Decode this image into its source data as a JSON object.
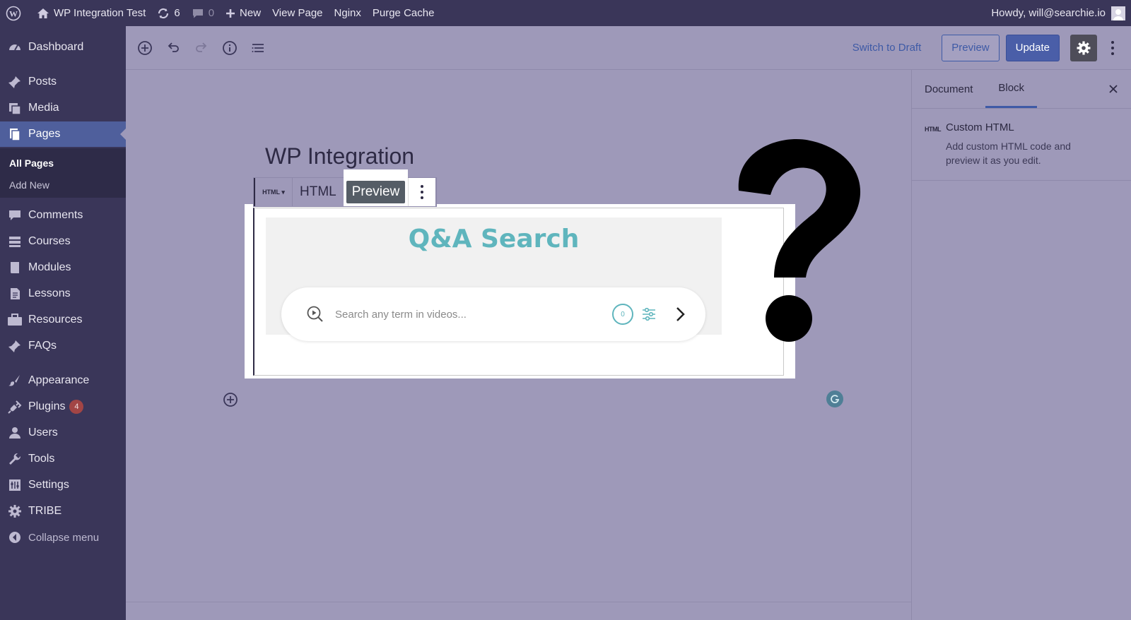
{
  "admin_bar": {
    "site_name": "WP Integration Test",
    "updates_count": "6",
    "comments_count": "0",
    "new_label": "New",
    "view_page": "View Page",
    "nginx": "Nginx",
    "purge_cache": "Purge Cache",
    "howdy": "Howdy, will@searchie.io"
  },
  "sidebar": {
    "items": [
      {
        "label": "Dashboard",
        "icon": "dashboard-icon"
      },
      {
        "label": "Posts",
        "icon": "pin-icon"
      },
      {
        "label": "Media",
        "icon": "media-icon"
      },
      {
        "label": "Pages",
        "icon": "pages-icon",
        "active": true
      },
      {
        "label": "Comments",
        "icon": "comment-icon"
      },
      {
        "label": "Courses",
        "icon": "courses-icon"
      },
      {
        "label": "Modules",
        "icon": "book-icon"
      },
      {
        "label": "Lessons",
        "icon": "document-icon"
      },
      {
        "label": "Resources",
        "icon": "briefcase-icon"
      },
      {
        "label": "FAQs",
        "icon": "pin-icon"
      },
      {
        "label": "Appearance",
        "icon": "brush-icon"
      },
      {
        "label": "Plugins",
        "icon": "plugin-icon",
        "badge": "4"
      },
      {
        "label": "Users",
        "icon": "user-icon"
      },
      {
        "label": "Tools",
        "icon": "wrench-icon"
      },
      {
        "label": "Settings",
        "icon": "settings-icon"
      },
      {
        "label": "TRIBE",
        "icon": "gear-icon"
      }
    ],
    "submenu": {
      "all_pages": "All Pages",
      "add_new": "Add New"
    },
    "collapse": "Collapse menu"
  },
  "header": {
    "switch_to_draft": "Switch to Draft",
    "preview": "Preview",
    "update": "Update"
  },
  "settings_panel": {
    "tabs": [
      "Document",
      "Block"
    ],
    "active_tab": "Block",
    "block_icon_text": "HTML",
    "block_title": "Custom HTML",
    "block_description": "Add custom HTML code and preview it as you edit."
  },
  "canvas": {
    "post_title": "WP Integration",
    "toolbar": {
      "switcher": "HTML ▾",
      "html_tab": "HTML",
      "preview_tab": "Preview"
    },
    "qa": {
      "title": "Q&A Search",
      "placeholder": "Search any term in videos...",
      "count": "0"
    }
  },
  "colors": {
    "overlay": "#9e99b9",
    "sidebar": "#3a3659",
    "accent": "#3e5aa6",
    "teal": "#5fb5bd"
  }
}
